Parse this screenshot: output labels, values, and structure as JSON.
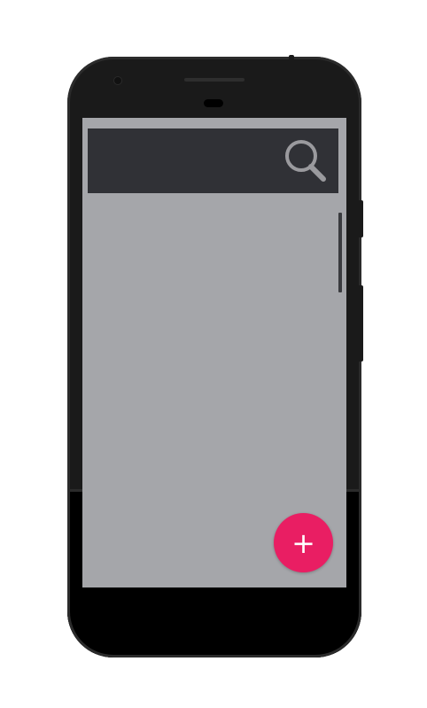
{
  "theme": {
    "screen_bg": "#a5a6aa",
    "toolbar_bg": "#303136",
    "accent": "#e91e63",
    "icon_color": "#9a9a9e"
  },
  "toolbar": {
    "search_icon": "search-icon"
  },
  "fab": {
    "icon": "plus-icon",
    "glyph": "+"
  }
}
